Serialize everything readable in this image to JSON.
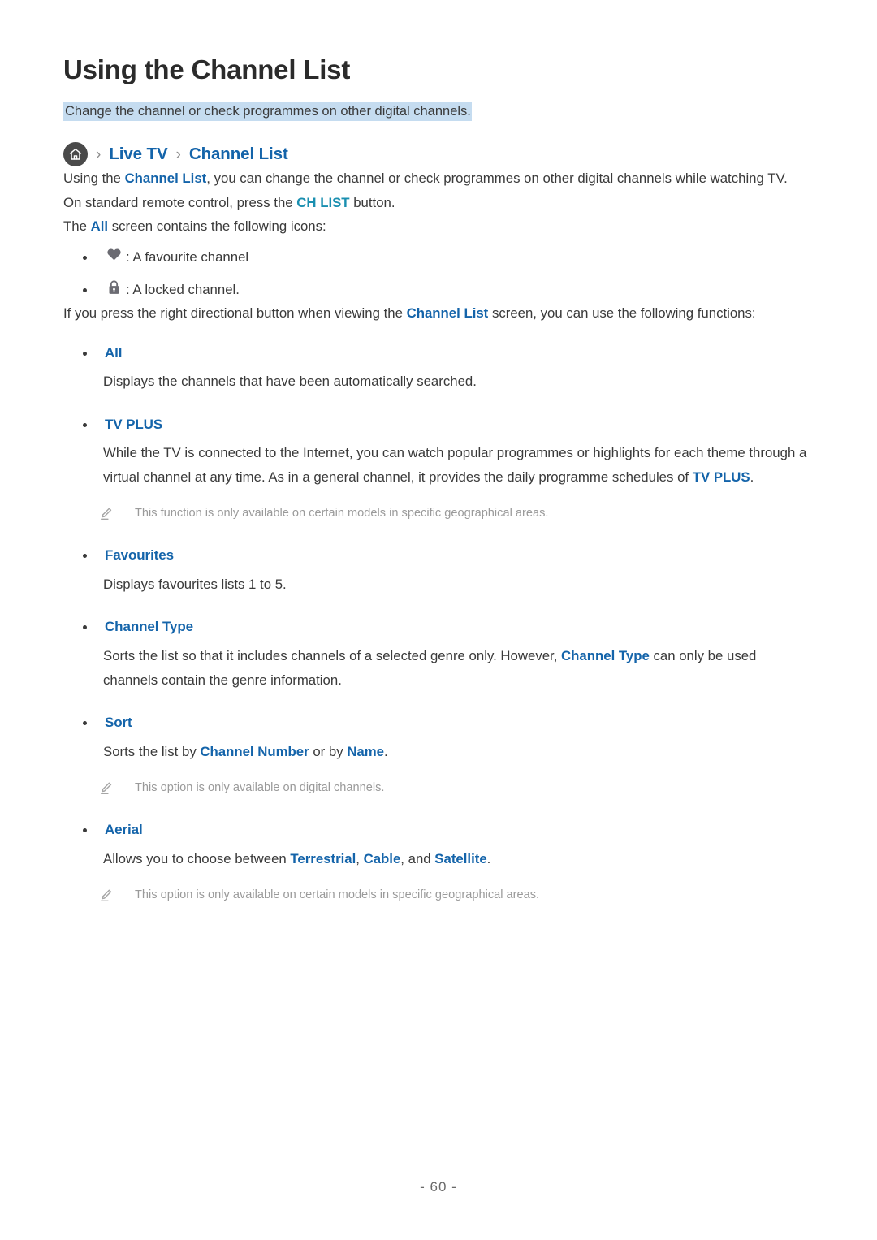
{
  "document": {
    "title": "Using the Channel List",
    "subtitle": "Change the channel or check programmes on other digital channels.",
    "page_number": "- 60 -"
  },
  "colors": {
    "link_blue": "#1464AA",
    "teal_blue": "#1A8FB0",
    "highlight": "#C5DCF0",
    "note_gray": "#9A9A9A",
    "body_text": "#3A3A3A"
  },
  "breadcrumb": {
    "home_icon": "home-icon",
    "separator": "›",
    "items": [
      {
        "label": "Live TV"
      },
      {
        "label": "Channel List"
      }
    ]
  },
  "intro": {
    "part1": "Using the ",
    "link1": "Channel List",
    "part2": ", you can change the channel or check programmes on other digital channels while watching TV. On standard remote control, press the ",
    "link2": "CH LIST",
    "part3": " button."
  },
  "icons_intro": {
    "part1": "The ",
    "link1": "All",
    "part2": " screen contains the following icons:"
  },
  "icon_list": [
    {
      "icon": "heart-icon",
      "text": ": A favourite channel"
    },
    {
      "icon": "lock-icon",
      "text": ": A locked channel."
    }
  ],
  "functions_intro": {
    "part1": "If you press the right directional button when viewing the ",
    "link1": "Channel List",
    "part2": " screen, you can use the following functions:"
  },
  "features": [
    {
      "label": "All",
      "desc": "Displays the channels that have been automatically searched."
    },
    {
      "label": "TV PLUS",
      "desc_part1": "While the TV is connected to the Internet, you can watch popular programmes or highlights for each theme through a virtual channel at any time. As in a general channel, it provides the daily programme schedules of ",
      "desc_link": "TV PLUS",
      "desc_part2": ".",
      "note": "This function is only available on certain models in specific geographical areas."
    },
    {
      "label": "Favourites",
      "desc": "Displays favourites lists 1 to 5."
    },
    {
      "label": "Channel Type",
      "desc_part1": "Sorts the list so that it includes channels of a selected genre only. However, ",
      "desc_link": "Channel Type",
      "desc_part2": " can only be used channels contain the genre information."
    },
    {
      "label": "Sort",
      "desc_part1": "Sorts the list by ",
      "desc_link1": "Channel Number",
      "desc_part2": " or by ",
      "desc_link2": "Name",
      "desc_part3": ".",
      "note": "This option is only available on digital channels."
    },
    {
      "label": "Aerial",
      "desc_part1": "Allows you to choose between ",
      "desc_link1": "Terrestrial",
      "desc_part2": ", ",
      "desc_link2": "Cable",
      "desc_part3": ", and ",
      "desc_link3": "Satellite",
      "desc_part4": ".",
      "note": "This option is only available on certain models in specific geographical areas."
    }
  ]
}
